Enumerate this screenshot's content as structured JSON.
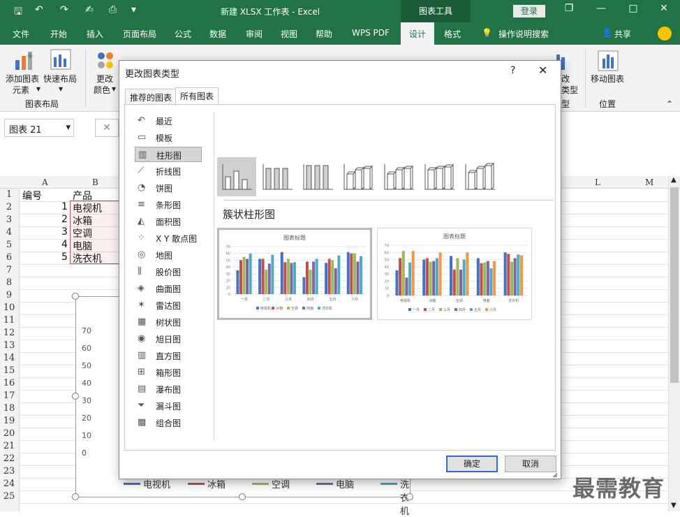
{
  "window": {
    "doc_title": "新建 XLSX 工作表 - Excel",
    "context_tab": "图表工具",
    "login": "登录",
    "minimize": "—",
    "restore": "❐",
    "maximize": "□",
    "close": "✕"
  },
  "menu_tabs": [
    "文件",
    "开始",
    "插入",
    "页面布局",
    "公式",
    "数据",
    "审阅",
    "视图",
    "帮助",
    "WPS PDF",
    "设计",
    "格式"
  ],
  "menu_active": "设计",
  "menu_search": "操作说明搜索",
  "menu_share": "共享",
  "ribbon": {
    "add_element": "添加图表",
    "add_element_2": "元素",
    "quick_layout": "快速布局",
    "change_color": "更改",
    "change_color_2": "颜色",
    "group_layout": "图表布局",
    "change_type_partial": "改",
    "change_type_partial_2": "类型",
    "group_type_partial": "型",
    "move_chart": "移动图表",
    "group_location": "位置"
  },
  "namebox": "图表 21",
  "formula_cancel": "✕",
  "columns": [
    "A",
    "B",
    "L",
    "M"
  ],
  "rows": [
    "1",
    "2",
    "3",
    "4",
    "5",
    "6",
    "7",
    "8",
    "9",
    "10",
    "11",
    "12",
    "13",
    "14",
    "15",
    "16",
    "17",
    "18",
    "19",
    "20",
    "21",
    "22",
    "23",
    "24",
    "25"
  ],
  "cells": {
    "a1": "编号",
    "b1": "产品",
    "a2": "1",
    "b2": "电视机",
    "a3": "2",
    "b3": "冰箱",
    "a4": "3",
    "b4": "空调",
    "a5": "4",
    "b5": "电脑",
    "a6": "5",
    "b6": "洗衣机"
  },
  "sheet_chart": {
    "yticks": [
      "70",
      "60",
      "50",
      "40",
      "30",
      "20",
      "10",
      "0"
    ],
    "legend": [
      "电视机",
      "冰箱",
      "空调",
      "电脑",
      "洗衣机"
    ],
    "legend_colors": [
      "#4472c4",
      "#c0504d",
      "#9bbb59",
      "#8064a2",
      "#4bacc6"
    ]
  },
  "dialog": {
    "title": "更改图表类型",
    "help": "?",
    "close": "✕",
    "tab_recommended": "推荐的图表",
    "tab_all": "所有图表",
    "chart_types": [
      "最近",
      "模板",
      "柱形图",
      "折线图",
      "饼图",
      "条形图",
      "面积图",
      "X Y 散点图",
      "地图",
      "股价图",
      "曲面图",
      "雷达图",
      "树状图",
      "旭日图",
      "直方图",
      "箱形图",
      "瀑布图",
      "漏斗图",
      "组合图"
    ],
    "selected_type": "柱形图",
    "subtype_title": "簇状柱形图",
    "ok": "确定",
    "cancel": "取消"
  },
  "previews": [
    {
      "title": "图表标题",
      "categories": [
        "一月",
        "二月",
        "三月",
        "四月",
        "五月",
        "六月"
      ],
      "legend": [
        "电视机",
        "冰箱",
        "空调",
        "电脑",
        "洗衣机"
      ],
      "colors": [
        "#4472c4",
        "#c0504d",
        "#9bbb59",
        "#8064a2",
        "#4bacc6"
      ],
      "values": [
        [
          35,
          52,
          62,
          25,
          46,
          62
        ],
        [
          50,
          52,
          47,
          48,
          52,
          60
        ],
        [
          55,
          36,
          52,
          36,
          50,
          60
        ],
        [
          52,
          45,
          46,
          48,
          38,
          48
        ],
        [
          60,
          58,
          47,
          52,
          57,
          56
        ]
      ]
    },
    {
      "title": "图表标题",
      "categories": [
        "电视机",
        "冰箱",
        "空调",
        "电脑",
        "洗衣机"
      ],
      "legend": [
        "一月",
        "二月",
        "三月",
        "四月",
        "五月",
        "六月"
      ],
      "colors": [
        "#4472c4",
        "#c0504d",
        "#9bbb59",
        "#8064a2",
        "#4bacc6",
        "#f79646"
      ],
      "values": [
        [
          35,
          50,
          55,
          52,
          60
        ],
        [
          52,
          52,
          36,
          45,
          58
        ],
        [
          62,
          47,
          52,
          46,
          47
        ],
        [
          25,
          48,
          36,
          48,
          52
        ],
        [
          46,
          52,
          50,
          38,
          57
        ],
        [
          62,
          60,
          60,
          48,
          56
        ]
      ]
    }
  ],
  "preview_yticks": [
    "70",
    "60",
    "50",
    "40",
    "30",
    "20",
    "10",
    "0"
  ],
  "watermark": "最需教育"
}
